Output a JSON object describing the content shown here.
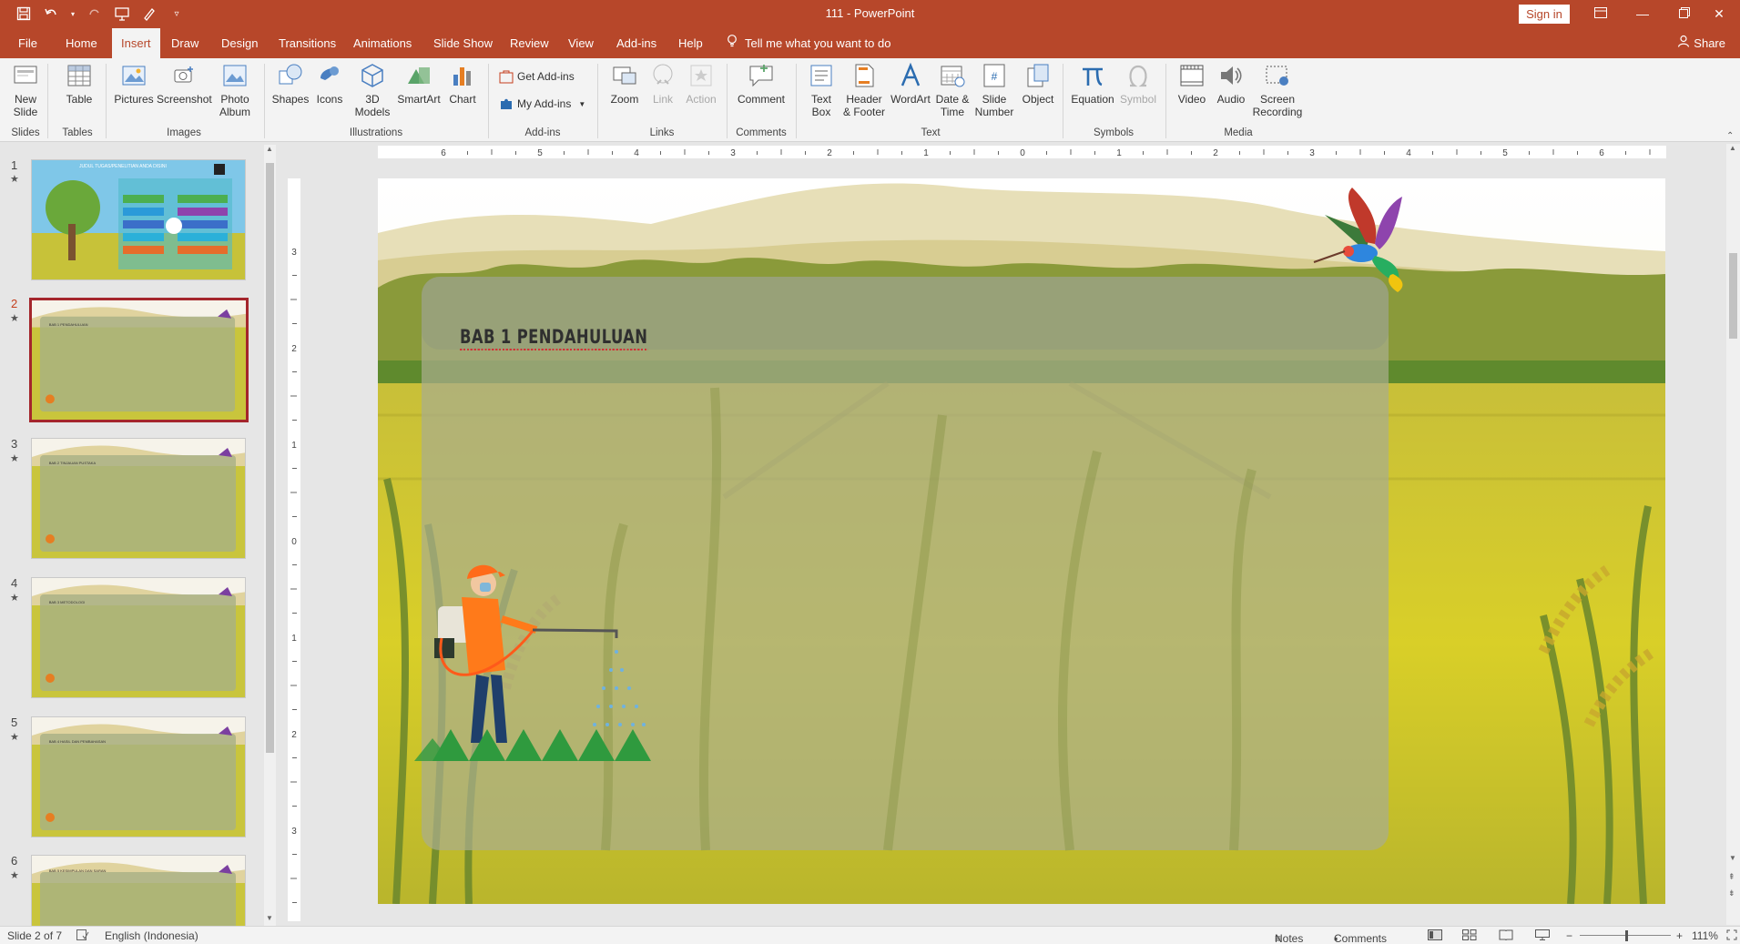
{
  "titlebar": {
    "title": "111  -  PowerPoint",
    "signin": "Sign in",
    "qat_icons": [
      "save-icon",
      "undo-icon",
      "redo-icon",
      "start-from-beginning-icon",
      "touch-mode-icon",
      "customize-qat-icon"
    ]
  },
  "tabs": {
    "items": [
      "File",
      "Home",
      "Insert",
      "Draw",
      "Design",
      "Transitions",
      "Animations",
      "Slide Show",
      "Review",
      "View",
      "Add-ins",
      "Help"
    ],
    "active": "Insert",
    "tell_me": "Tell me what you want to do",
    "share": "Share"
  },
  "ribbon": {
    "new_slide": "New Slide",
    "table": "Table",
    "pictures": "Pictures",
    "screenshot": "Screenshot",
    "photo_album": "Photo Album",
    "shapes": "Shapes",
    "icons": "Icons",
    "models_3d": "3D Models",
    "smartart": "SmartArt",
    "chart": "Chart",
    "get_addins": "Get Add-ins",
    "my_addins": "My Add-ins",
    "zoom": "Zoom",
    "link": "Link",
    "action": "Action",
    "comment": "Comment",
    "text_box": "Text Box",
    "header_footer": "Header & Footer",
    "wordart": "WordArt",
    "date_time": "Date & Time",
    "slide_number": "Slide Number",
    "object": "Object",
    "equation": "Equation",
    "symbol": "Symbol",
    "video": "Video",
    "audio": "Audio",
    "screen_recording": "Screen Recording",
    "groups": {
      "slides": "Slides",
      "tables": "Tables",
      "images": "Images",
      "illustrations": "Illustrations",
      "addins": "Add-ins",
      "links": "Links",
      "comments": "Comments",
      "text": "Text",
      "symbols": "Symbols",
      "media": "Media"
    }
  },
  "thumbnails": [
    {
      "num": "1",
      "title": "JUDUL TUGAS/PENELITIAN ANDA DISINI"
    },
    {
      "num": "2",
      "title": "BAB 1 PENDAHULUAN"
    },
    {
      "num": "3",
      "title": "BAB 2 TINJAUAN PUSTAKA"
    },
    {
      "num": "4",
      "title": "BAB 3 METODOLOGI"
    },
    {
      "num": "5",
      "title": "BAB 4 HASIL DAN PEMBAHASAN"
    },
    {
      "num": "6",
      "title": "BAB 5 KESIMPULAN DAN SARAN"
    }
  ],
  "slide": {
    "title": "BAB 1 PENDAHULUAN"
  },
  "ruler": {
    "h_labels": [
      "6",
      "5",
      "4",
      "3",
      "2",
      "1",
      "0",
      "1",
      "2",
      "3",
      "4",
      "5",
      "6"
    ],
    "v_labels": [
      "3",
      "2",
      "1",
      "0",
      "1",
      "2",
      "3"
    ]
  },
  "statusbar": {
    "slide_info": "Slide 2 of 7",
    "language": "English (Indonesia)",
    "notes": "Notes",
    "comments": "Comments",
    "zoom": "111%"
  },
  "colors": {
    "accent": "#b7472a",
    "selection": "#a4262c"
  }
}
